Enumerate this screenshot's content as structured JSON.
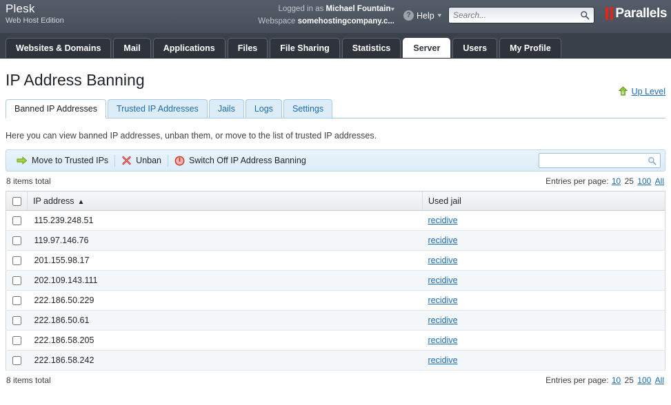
{
  "header": {
    "brand_name": "Plesk",
    "brand_edition": "Web Host Edition",
    "logged_in_label": "Logged in as",
    "logged_in_user": "Michael Fountain",
    "webspace_label": "Webspace",
    "webspace_value": "somehostingcompany.c...",
    "help_label": "Help",
    "help_icon": "question-circle-icon",
    "search_placeholder": "Search...",
    "search_value": "",
    "search_icon": "search-icon",
    "vendor_logo": "Parallels"
  },
  "nav_tabs": [
    {
      "label": "Websites & Domains",
      "active": false
    },
    {
      "label": "Mail",
      "active": false
    },
    {
      "label": "Applications",
      "active": false
    },
    {
      "label": "Files",
      "active": false
    },
    {
      "label": "File Sharing",
      "active": false
    },
    {
      "label": "Statistics",
      "active": false
    },
    {
      "label": "Server",
      "active": true
    },
    {
      "label": "Users",
      "active": false
    },
    {
      "label": "My Profile",
      "active": false
    }
  ],
  "page": {
    "title": "IP Address Banning",
    "up_level_label": "Up Level",
    "up_level_icon": "up-arrow-icon",
    "description": "Here you can view banned IP addresses, unban them, or move to the list of trusted IP addresses."
  },
  "sub_tabs": [
    {
      "label": "Banned IP Addresses",
      "active": true
    },
    {
      "label": "Trusted IP Addresses",
      "active": false
    },
    {
      "label": "Jails",
      "active": false
    },
    {
      "label": "Logs",
      "active": false
    },
    {
      "label": "Settings",
      "active": false
    }
  ],
  "toolbar": {
    "move_label": "Move to Trusted IPs",
    "move_icon": "green-arrow-right-icon",
    "unban_label": "Unban",
    "unban_icon": "red-x-icon",
    "switch_off_label": "Switch Off IP Address Banning",
    "switch_off_icon": "power-off-icon",
    "search_placeholder": "",
    "search_value": "",
    "search_icon": "search-icon"
  },
  "list": {
    "items_total": "8 items total",
    "entries_per_page_label": "Entries per page:",
    "entries_options": [
      "10",
      "25",
      "100",
      "All"
    ],
    "entries_selected": "25",
    "columns": {
      "select_all": "select-all-checkbox",
      "ip_address": "IP address",
      "sort_indicator": "ascending",
      "used_jail": "Used jail"
    },
    "rows": [
      {
        "checked": false,
        "ip": "115.239.248.51",
        "jail": "recidive"
      },
      {
        "checked": false,
        "ip": "119.97.146.76",
        "jail": "recidive"
      },
      {
        "checked": false,
        "ip": "201.155.98.17",
        "jail": "recidive"
      },
      {
        "checked": false,
        "ip": "202.109.143.111",
        "jail": "recidive"
      },
      {
        "checked": false,
        "ip": "222.186.50.229",
        "jail": "recidive"
      },
      {
        "checked": false,
        "ip": "222.186.50.61",
        "jail": "recidive"
      },
      {
        "checked": false,
        "ip": "222.186.58.205",
        "jail": "recidive"
      },
      {
        "checked": false,
        "ip": "222.186.58.242",
        "jail": "recidive"
      }
    ]
  },
  "colors": {
    "header_bg": "#4c5561",
    "nav_bg": "#3a414b",
    "link": "#1a6bb5",
    "accent_red": "#e1251b",
    "toolbar_bg": "#dcecf8",
    "row_alt": "#f4f8fb"
  }
}
